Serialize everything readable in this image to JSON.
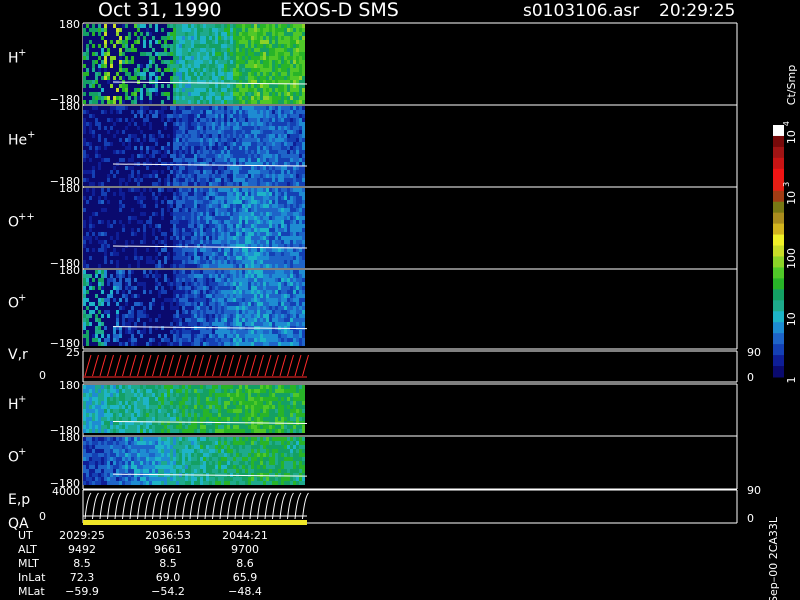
{
  "header": {
    "date": "Oct 31, 1990",
    "instrument": "EXOS-D SMS",
    "file": "s0103106.asr",
    "time": "20:29:25"
  },
  "chart_data": {
    "type": "heatmap",
    "panels": [
      {
        "species": "H",
        "charge": "+",
        "ymax": "180",
        "ymin": "−180",
        "intensity": [
          0.55,
          0.78,
          0.62,
          0.48,
          0.58,
          0.46,
          0.5,
          0.52,
          0.64,
          0.68,
          0.66,
          0.68
        ]
      },
      {
        "species": "He",
        "charge": "+",
        "ymax": "180",
        "ymin": "−180",
        "intensity": [
          0.1,
          0.12,
          0.14,
          0.16,
          0.18,
          0.2,
          0.22,
          0.24,
          0.26,
          0.28,
          0.26,
          0.24
        ]
      },
      {
        "species": "O",
        "charge": "++",
        "ymax": "180",
        "ymin": "−180",
        "intensity": [
          0.14,
          0.12,
          0.1,
          0.12,
          0.16,
          0.2,
          0.24,
          0.28,
          0.32,
          0.34,
          0.3,
          0.28
        ]
      },
      {
        "species": "O",
        "charge": "+",
        "ymax": "180",
        "ymin": "−180",
        "intensity": [
          0.5,
          0.3,
          0.2,
          0.14,
          0.14,
          0.18,
          0.22,
          0.28,
          0.32,
          0.34,
          0.3,
          0.28
        ]
      }
    ],
    "vr_panel": {
      "label": "V,r",
      "ymax": "25",
      "ymin": "0",
      "right_max": "90",
      "right_min": "0"
    },
    "low_panels": [
      {
        "species": "H",
        "charge": "+",
        "ymax": "180",
        "ymin": "−180",
        "intensity": [
          0.42,
          0.48,
          0.5,
          0.52,
          0.55,
          0.58,
          0.6,
          0.62,
          0.64,
          0.66,
          0.64,
          0.62
        ]
      },
      {
        "species": "O",
        "charge": "+",
        "ymax": "180",
        "ymin": "−180",
        "intensity": [
          0.2,
          0.24,
          0.3,
          0.36,
          0.42,
          0.48,
          0.52,
          0.56,
          0.58,
          0.6,
          0.58,
          0.56
        ]
      }
    ],
    "ep_panel": {
      "label_top": "E,p",
      "label_bottom": "QA",
      "ymax": "4000",
      "ymin": "0",
      "right_max": "90",
      "right_min": "0"
    },
    "colorbar": {
      "unit": "Ct/Smp",
      "ticks": [
        {
          "value": 1,
          "label": "1"
        },
        {
          "value": 10,
          "label": "10"
        },
        {
          "value": 100,
          "label": "100"
        },
        {
          "value": 1000,
          "label": "10",
          "exponent": "3"
        },
        {
          "value": 10000,
          "label": "10",
          "exponent": "4"
        }
      ],
      "colors": [
        "#0a0a6e",
        "#0e1e96",
        "#1440b4",
        "#1e64c8",
        "#1e8cd2",
        "#1eb4c8",
        "#1eaa8c",
        "#14a064",
        "#28b428",
        "#50c828",
        "#8cd228",
        "#c8dc28",
        "#f0f028",
        "#d2b41e",
        "#aa8c1e",
        "#787814",
        "#a03c14",
        "#e61e14",
        "#f01414",
        "#c81414",
        "#a01414",
        "#780a0a",
        "#ffffff"
      ]
    },
    "orbit": {
      "rows": [
        {
          "label": "UT",
          "values": [
            "2029:25",
            "2036:53",
            "2044:21"
          ]
        },
        {
          "label": "ALT",
          "values": [
            "9492",
            "9661",
            "9700"
          ]
        },
        {
          "label": "MLT",
          "values": [
            "8.5",
            "8.5",
            "8.6"
          ]
        },
        {
          "label": "InLat",
          "values": [
            "72.3",
            "69.0",
            "65.9"
          ]
        },
        {
          "label": "MLat",
          "values": [
            "−59.9",
            "−54.2",
            "−48.4"
          ]
        }
      ]
    },
    "footer": "Sep–00 2CA33L"
  }
}
